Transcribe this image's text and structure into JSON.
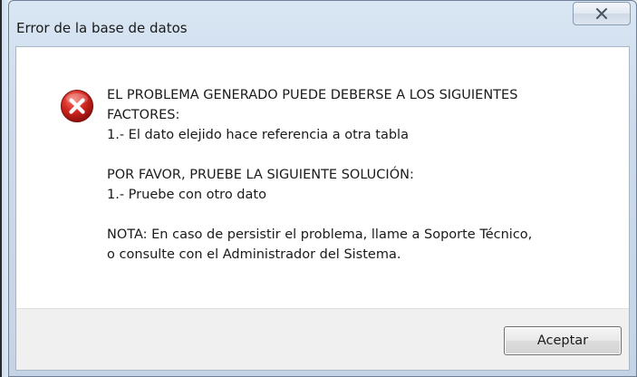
{
  "window": {
    "title": "Error de la base de datos",
    "close_icon": "close-icon"
  },
  "dialog": {
    "icon": "error-icon",
    "icon_color": "#d2251f",
    "lines": {
      "l1": "EL PROBLEMA GENERADO PUEDE DEBERSE A LOS SIGUIENTES",
      "l2": "FACTORES:",
      "l3": "1.- El dato elejido hace referencia a otra tabla",
      "l4": "POR FAVOR, PRUEBE LA SIGUIENTE SOLUCIÓN:",
      "l5": "1.- Pruebe con otro dato",
      "l6": "NOTA: En caso de persistir el problema, llame a Soporte Técnico,",
      "l7": "o consulte con el Administrador del Sistema."
    }
  },
  "buttons": {
    "accept_label": "Aceptar"
  }
}
